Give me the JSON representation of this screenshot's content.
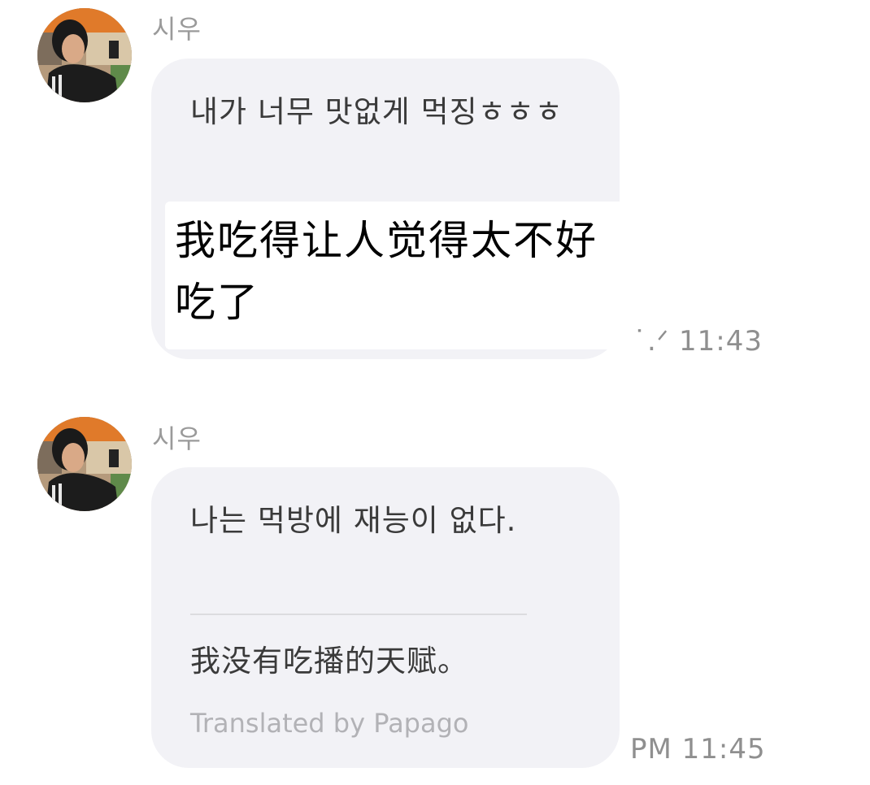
{
  "messages": [
    {
      "sender": "시우",
      "avatar": "profile-photo",
      "text": "내가 너무 맛없게 먹징ㅎㅎㅎ",
      "overlay_translation": "我吃得让人觉得太不好吃了",
      "time": "PM 11:43",
      "time_visible": "˙.ᐟ 11:43"
    },
    {
      "sender": "시우",
      "avatar": "profile-photo",
      "text": "나는 먹방에 재능이 없다.",
      "translation": "我没有吃播的天赋。",
      "translation_credit": "Translated by Papago",
      "time": "PM 11:45"
    }
  ],
  "colors": {
    "bubble": "#f2f2f6",
    "text": "#3a3a3a",
    "meta": "#9a9a9a",
    "credit": "#b2b2b6"
  }
}
